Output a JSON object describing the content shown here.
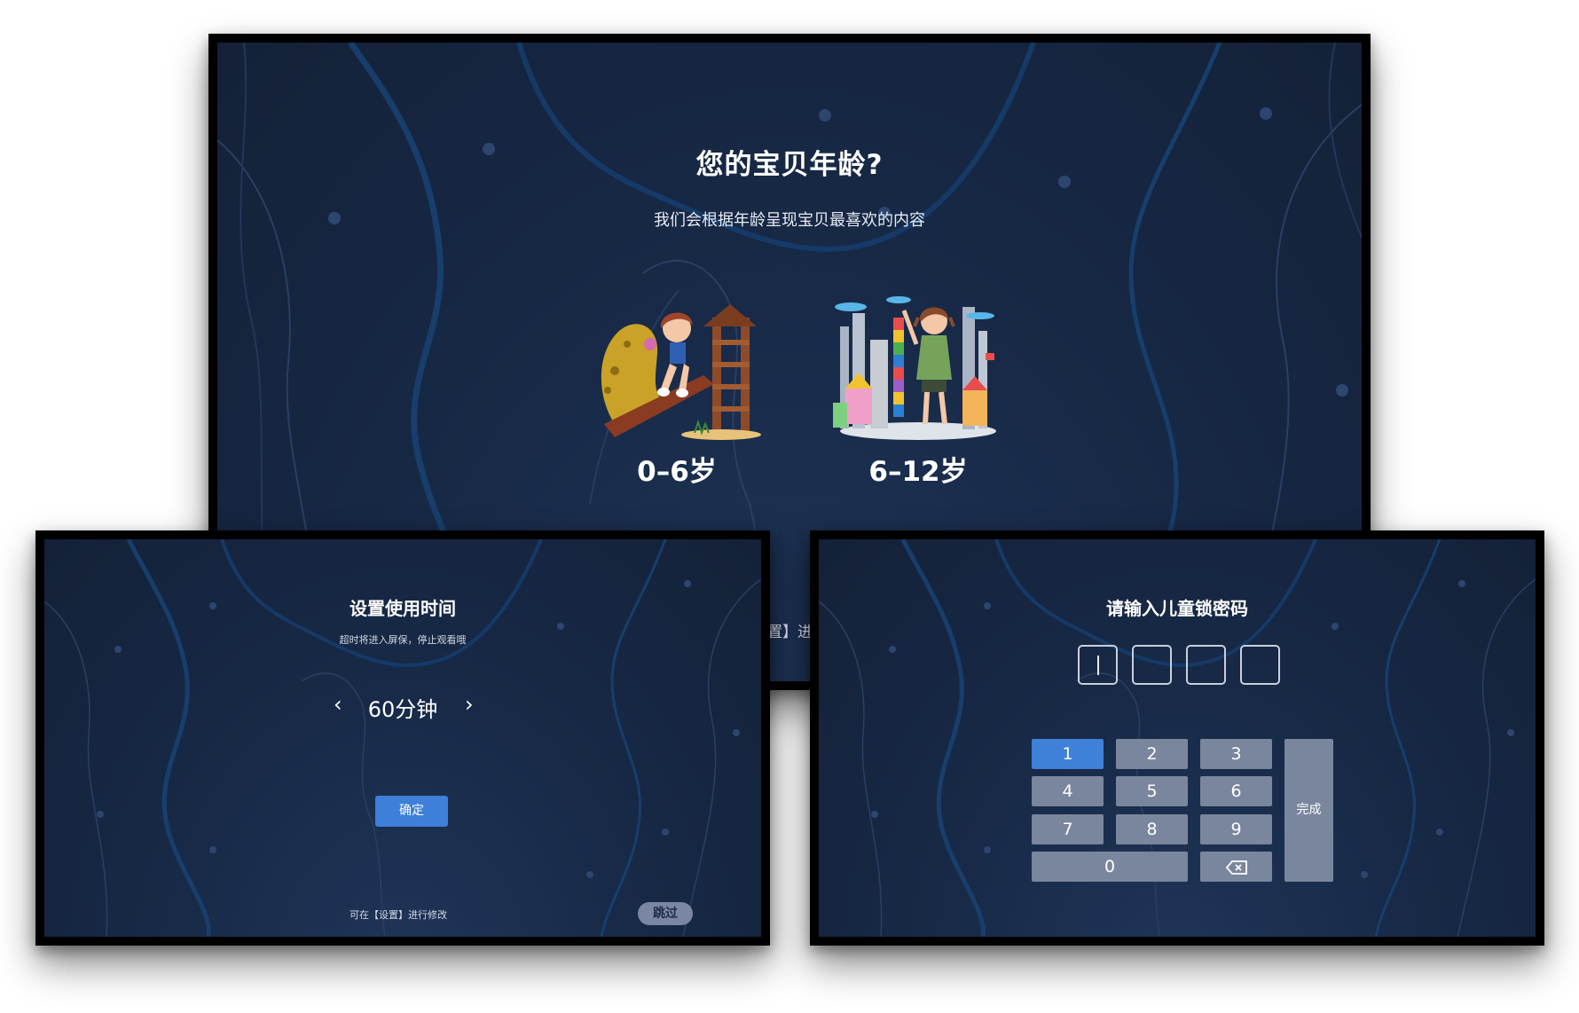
{
  "age_screen": {
    "title": "您的宝贝年龄?",
    "subtitle": "我们会根据年龄呈现宝贝最喜欢的内容",
    "options": [
      {
        "label": "0–6岁"
      },
      {
        "label": "6–12岁"
      }
    ],
    "peek_text": "置】进"
  },
  "time_screen": {
    "title": "设置使用时间",
    "subtitle": "超时将进入屏保，停止观看哦",
    "value": "60分钟",
    "prev_icon": "chevron-left-icon",
    "next_icon": "chevron-right-icon",
    "confirm_label": "确定",
    "hint": "可在【设置】进行修改",
    "skip_label": "跳过"
  },
  "lock_screen": {
    "title": "请输入儿童锁密码",
    "keys": [
      "1",
      "2",
      "3",
      "4",
      "5",
      "6",
      "7",
      "8",
      "9",
      "0"
    ],
    "done_label": "完成",
    "backspace_icon": "backspace-icon"
  },
  "colors": {
    "background": "#182a48",
    "accent": "#3d7fd9",
    "key": "#7a869e",
    "skip": "#7b87a2"
  }
}
